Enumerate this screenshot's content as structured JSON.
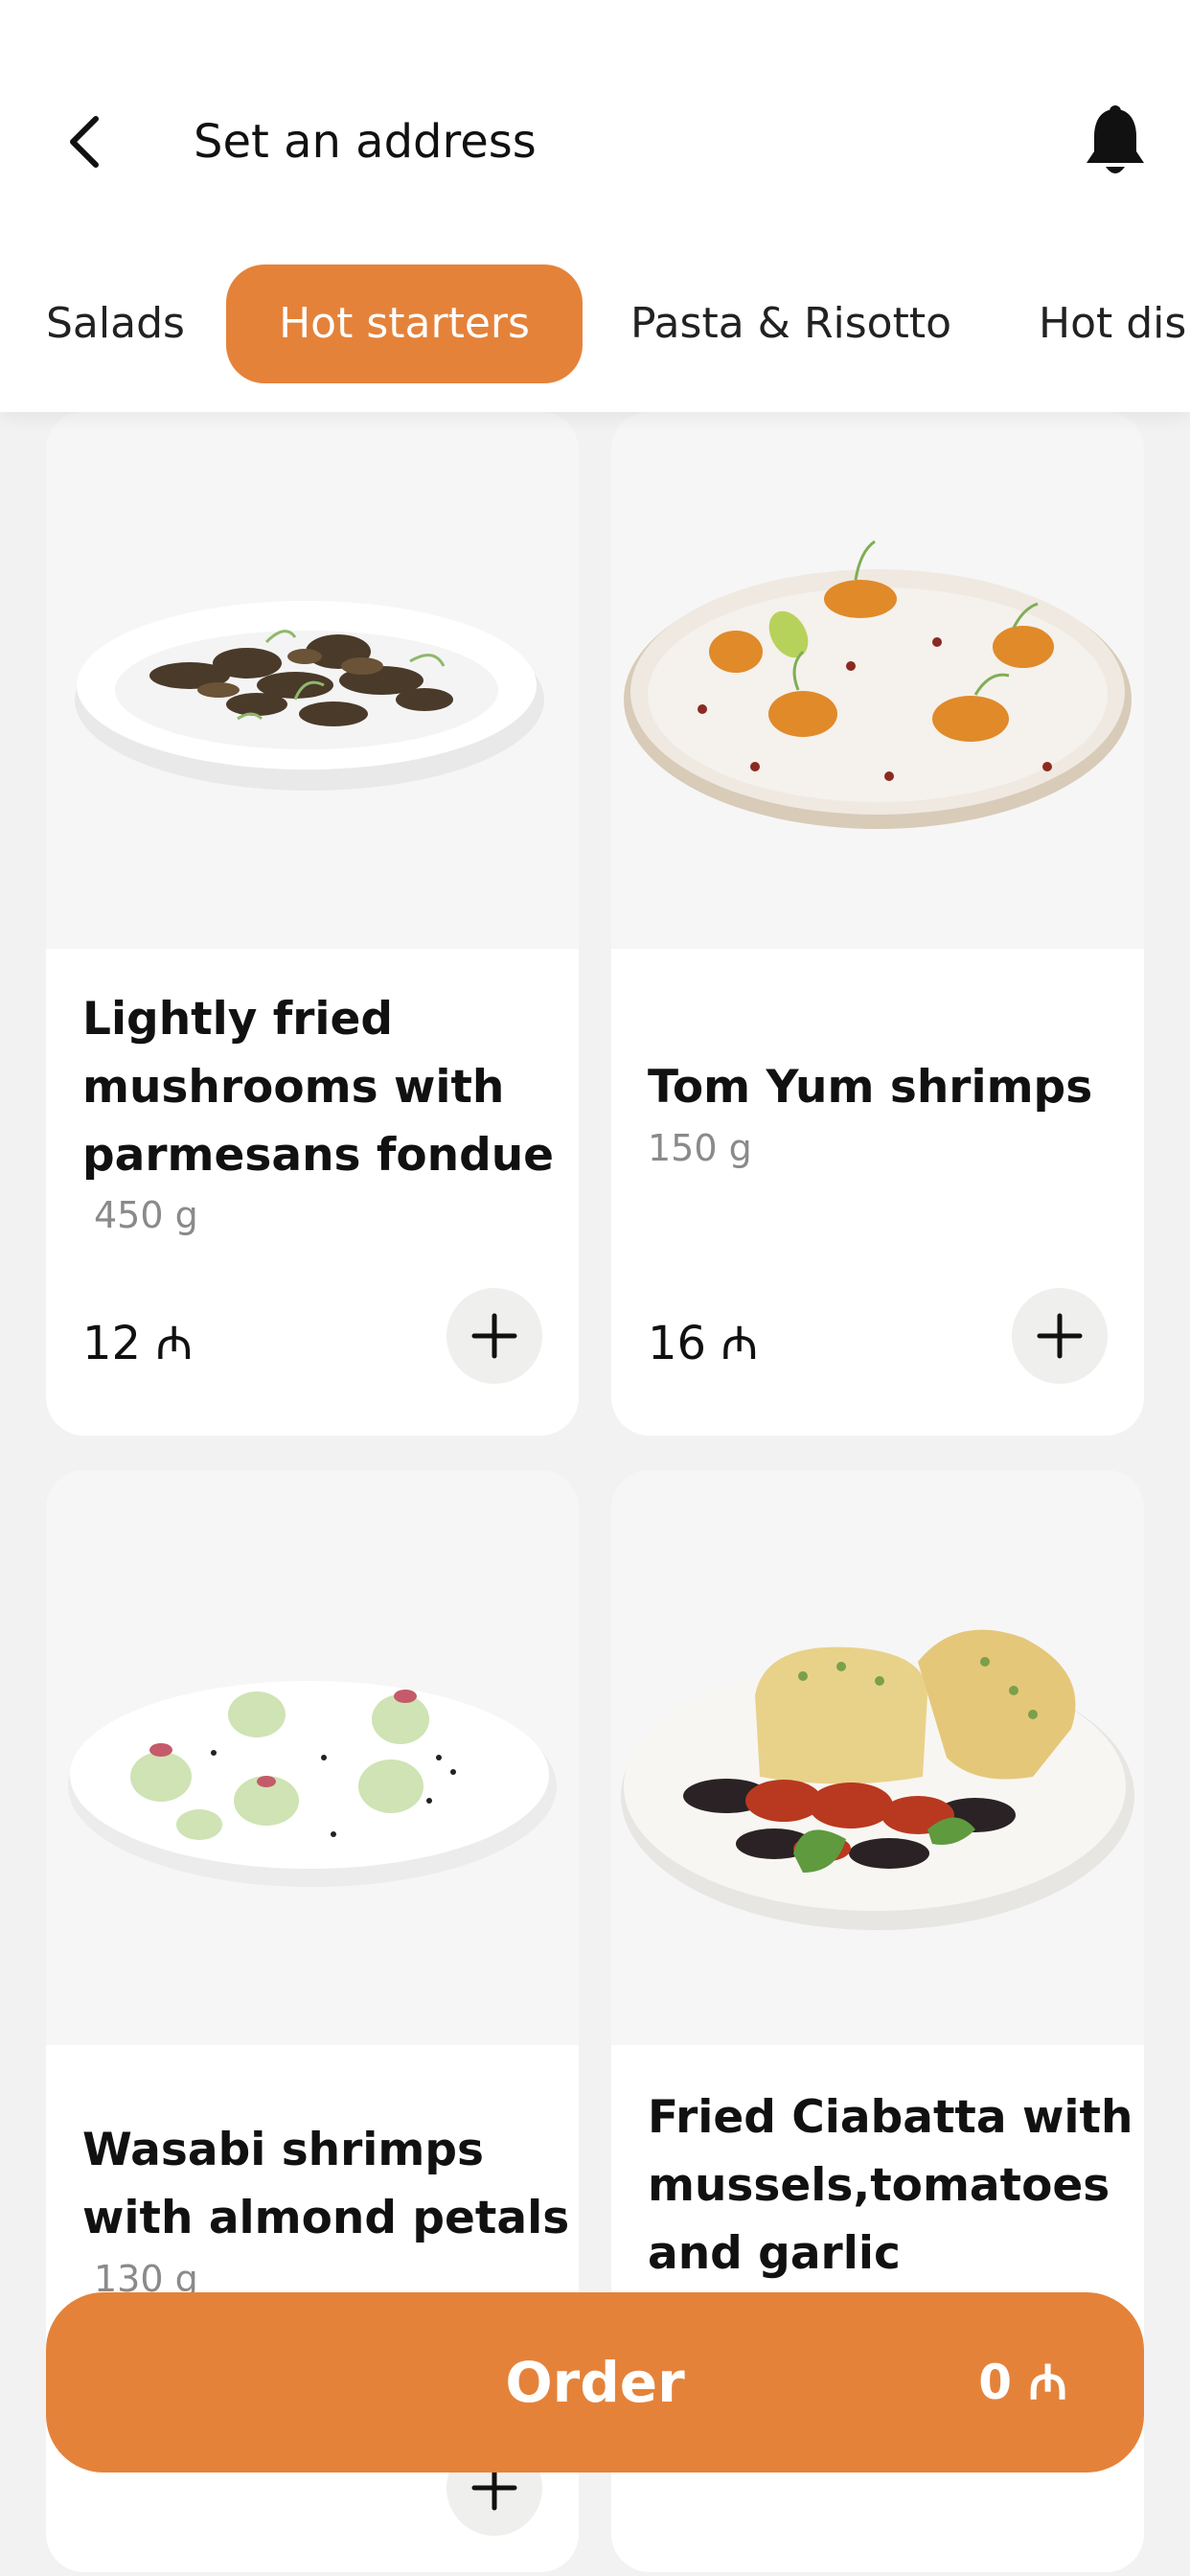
{
  "header": {
    "title": "Set an address",
    "back_icon": "chevron-left-icon",
    "bell_icon": "bell-icon"
  },
  "tabs": [
    {
      "label": "Salads",
      "active": false
    },
    {
      "label": "Hot starters",
      "active": true
    },
    {
      "label": "Pasta & Risotto",
      "active": false
    },
    {
      "label": "Hot dis",
      "active": false
    }
  ],
  "items": [
    {
      "name_lines": [
        "Lightly fried",
        "mushrooms with",
        "parmesans fondue"
      ],
      "weight": "450 g",
      "price": "12 ₼"
    },
    {
      "name_lines": [
        "Tom Yum shrimps"
      ],
      "weight": "150 g",
      "price": "16 ₼"
    },
    {
      "name_lines": [
        "Wasabi shrimps",
        "with almond petals"
      ],
      "weight": "130 g",
      "price": ""
    },
    {
      "name_lines": [
        "Fried Ciabatta with",
        "mussels,tomatoes",
        "and garlic"
      ],
      "weight": "",
      "price": ""
    }
  ],
  "order": {
    "label": "Order",
    "total": "0 ₼"
  },
  "colors": {
    "accent": "#E5823A",
    "background": "#F2F2F2",
    "card": "#FFFFFF",
    "muted_text": "#8A8A8A"
  }
}
